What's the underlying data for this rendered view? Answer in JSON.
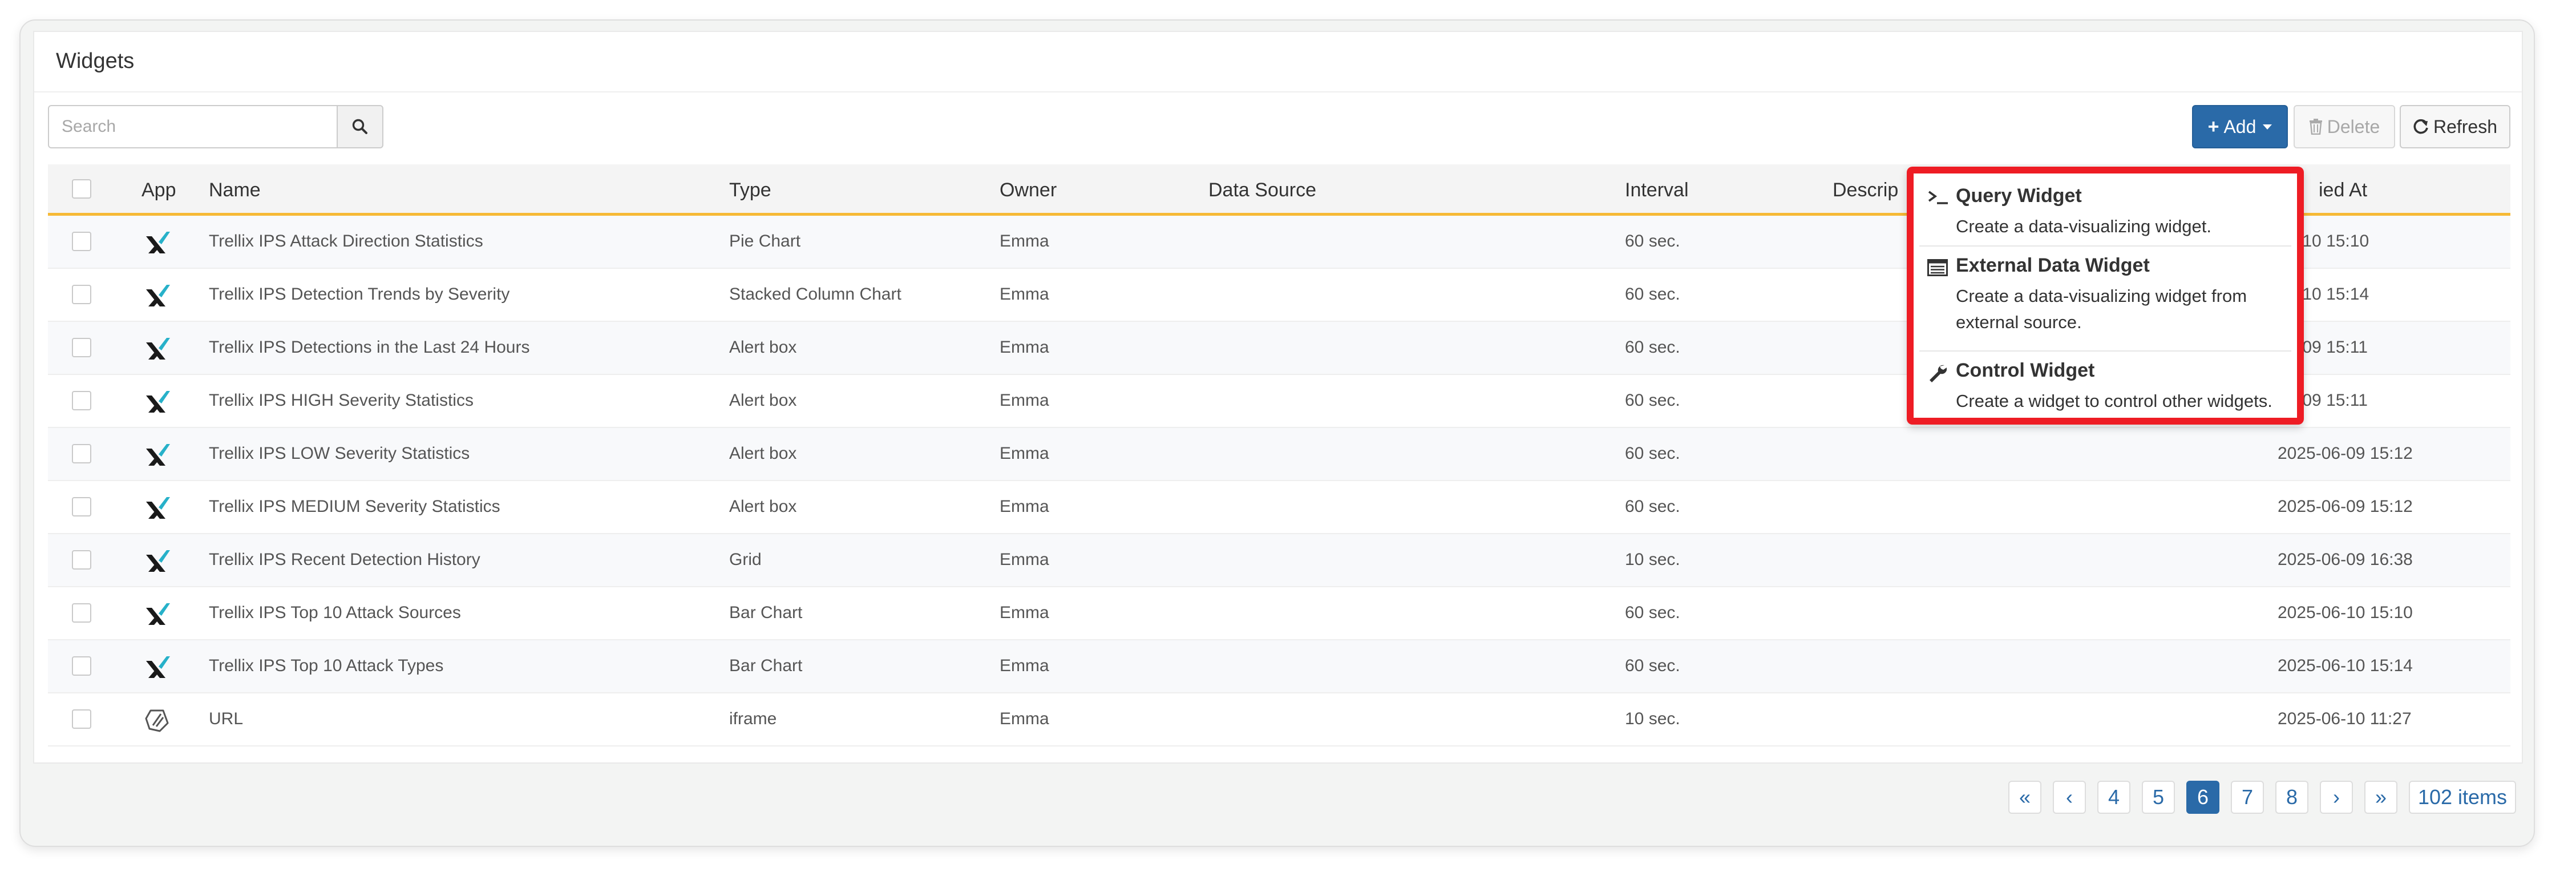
{
  "panel": {
    "title": "Widgets"
  },
  "search": {
    "placeholder": "Search",
    "value": ""
  },
  "toolbar": {
    "add_label": "Add",
    "delete_label": "Delete",
    "refresh_label": "Refresh"
  },
  "table": {
    "columns": {
      "app": "App",
      "name": "Name",
      "type": "Type",
      "owner": "Owner",
      "data_source": "Data Source",
      "interval": "Interval",
      "description": "Descrip",
      "modified_at": "ied At"
    },
    "rows": [
      {
        "app_icon": "trellix-icon",
        "name": "Trellix IPS Attack Direction Statistics",
        "type": "Pie Chart",
        "owner": "Emma",
        "data_source": "",
        "interval": "60 sec.",
        "modified_at": "06-10 15:10"
      },
      {
        "app_icon": "trellix-icon",
        "name": "Trellix IPS Detection Trends by Severity",
        "type": "Stacked Column Chart",
        "owner": "Emma",
        "data_source": "",
        "interval": "60 sec.",
        "modified_at": "06-10 15:14"
      },
      {
        "app_icon": "trellix-icon",
        "name": "Trellix IPS Detections in the Last 24 Hours",
        "type": "Alert box",
        "owner": "Emma",
        "data_source": "",
        "interval": "60 sec.",
        "modified_at": "06-09 15:11"
      },
      {
        "app_icon": "trellix-icon",
        "name": "Trellix IPS HIGH Severity Statistics",
        "type": "Alert box",
        "owner": "Emma",
        "data_source": "",
        "interval": "60 sec.",
        "modified_at": "06-09 15:11"
      },
      {
        "app_icon": "trellix-icon",
        "name": "Trellix IPS LOW Severity Statistics",
        "type": "Alert box",
        "owner": "Emma",
        "data_source": "",
        "interval": "60 sec.",
        "modified_at": "2025-06-09 15:12"
      },
      {
        "app_icon": "trellix-icon",
        "name": "Trellix IPS MEDIUM Severity Statistics",
        "type": "Alert box",
        "owner": "Emma",
        "data_source": "",
        "interval": "60 sec.",
        "modified_at": "2025-06-09 15:12"
      },
      {
        "app_icon": "trellix-icon",
        "name": "Trellix IPS Recent Detection History",
        "type": "Grid",
        "owner": "Emma",
        "data_source": "",
        "interval": "10 sec.",
        "modified_at": "2025-06-09 16:38"
      },
      {
        "app_icon": "trellix-icon",
        "name": "Trellix IPS Top 10 Attack Sources",
        "type": "Bar Chart",
        "owner": "Emma",
        "data_source": "",
        "interval": "60 sec.",
        "modified_at": "2025-06-10 15:10"
      },
      {
        "app_icon": "trellix-icon",
        "name": "Trellix IPS Top 10 Attack Types",
        "type": "Bar Chart",
        "owner": "Emma",
        "data_source": "",
        "interval": "60 sec.",
        "modified_at": "2025-06-10 15:14"
      },
      {
        "app_icon": "url-icon",
        "name": "URL",
        "type": "iframe",
        "owner": "Emma",
        "data_source": "",
        "interval": "10 sec.",
        "modified_at": "2025-06-10 11:27"
      }
    ]
  },
  "add_menu": {
    "items": [
      {
        "icon": "terminal-icon",
        "title": "Query Widget",
        "description": "Create a data-visualizing widget."
      },
      {
        "icon": "list-icon",
        "title": "External Data Widget",
        "description": "Create a data-visualizing widget from external source."
      },
      {
        "icon": "wrench-icon",
        "title": "Control Widget",
        "description": "Create a widget to control other widgets."
      }
    ]
  },
  "pagination": {
    "first": "«",
    "prev": "‹",
    "pages": [
      "4",
      "5",
      "6",
      "7",
      "8"
    ],
    "current_page": "6",
    "next": "›",
    "last": "»",
    "total": "102 items"
  },
  "colors": {
    "primary": "#2a6aa8",
    "header_underline": "#f6b935",
    "highlight_border": "#ee1c24",
    "trellix_teal": "#27b1c9"
  }
}
